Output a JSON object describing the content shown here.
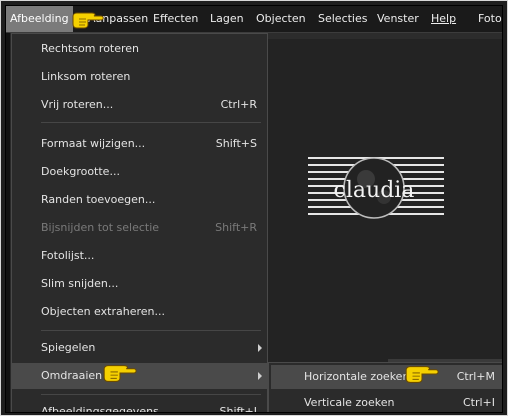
{
  "menubar": {
    "items": [
      {
        "label": "Afbeelding",
        "active": true
      },
      {
        "label": "Aanpassen"
      },
      {
        "label": "Effecten"
      },
      {
        "label": "Lagen"
      },
      {
        "label": "Objecten"
      },
      {
        "label": "Selecties"
      },
      {
        "label": "Venster"
      },
      {
        "label": "Help"
      },
      {
        "label": "Foto"
      }
    ]
  },
  "image_menu": {
    "items": [
      {
        "label": "Rechtsom roteren",
        "shortcut": ""
      },
      {
        "label": "Linksom roteren",
        "shortcut": ""
      },
      {
        "label": "Vrij roteren...",
        "shortcut": "Ctrl+R"
      },
      {
        "label": "Formaat wijzigen...",
        "shortcut": "Shift+S"
      },
      {
        "label": "Doekgrootte...",
        "shortcut": ""
      },
      {
        "label": "Randen toevoegen...",
        "shortcut": ""
      },
      {
        "label": "Bijsnijden tot selectie",
        "shortcut": "Shift+R",
        "disabled": true
      },
      {
        "label": "Fotolijst...",
        "shortcut": ""
      },
      {
        "label": "Slim snijden...",
        "shortcut": ""
      },
      {
        "label": "Objecten extraheren...",
        "shortcut": ""
      },
      {
        "label": "Spiegelen",
        "shortcut": "",
        "submenu": true
      },
      {
        "label": "Omdraaien",
        "shortcut": "",
        "submenu": true,
        "highlighted": true
      },
      {
        "label": "Afbeeldingsgegevens...",
        "shortcut": "Shift+I"
      }
    ]
  },
  "flip_submenu": {
    "items": [
      {
        "label": "Horizontale zoeken",
        "shortcut": "Ctrl+M",
        "highlighted": true
      },
      {
        "label": "Verticale zoeken",
        "shortcut": "Ctrl+I"
      }
    ]
  },
  "watermark": {
    "text": "claudia"
  },
  "colors": {
    "menubar_bg": "#1a1a1a",
    "menu_bg": "#2b2b2b",
    "highlight": "#4a4a4a",
    "active_menu": "#7b7b7b",
    "pointer_hand": "#f5d000"
  },
  "icons": {
    "pointer": "pointing-hand-icon",
    "submenu_arrow": "chevron-right-icon"
  }
}
